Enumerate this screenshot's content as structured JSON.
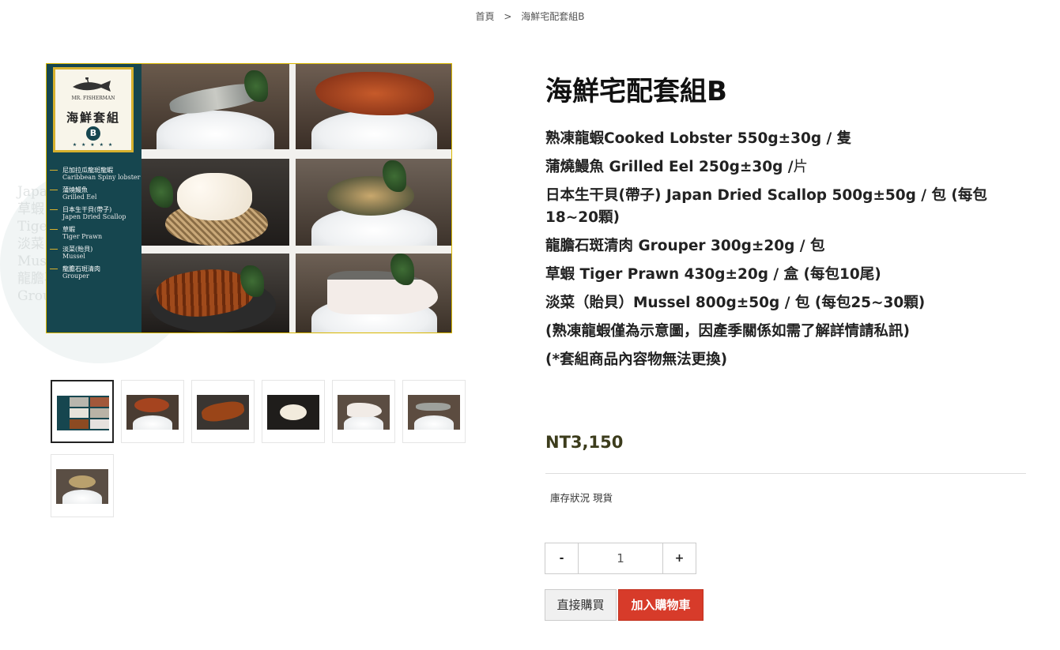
{
  "breadcrumb": {
    "home": "首頁",
    "separator": ">",
    "current": "海鮮宅配套組B"
  },
  "product_image": {
    "badge_brand": "MR. FISHERMAN",
    "badge_title": "海鮮套組",
    "badge_set": "B",
    "badge_stars": "★ ★ ★ ★ ★",
    "items": [
      {
        "zh": "尼加拉瓜龍斑龍蝦",
        "en": "Caribbean Spiny lobster"
      },
      {
        "zh": "蒲燒鰻魚",
        "en": "Grilled Eel"
      },
      {
        "zh": "日本生干貝(帶子)",
        "en": "Japen Dried Scallop"
      },
      {
        "zh": "草蝦",
        "en": "Tiger Prawn"
      },
      {
        "zh": "淡菜(貽貝)",
        "en": "Mussel"
      },
      {
        "zh": "龍膽石斑清肉",
        "en": "Grouper"
      }
    ],
    "watermark_lines": [
      "Japan Dried S",
      "草蝦",
      "Tiger Prawn",
      "淡菜",
      "Mussel",
      "龍膽石斑清肉",
      "Grouper"
    ]
  },
  "thumbnails": [
    {
      "name": "combo"
    },
    {
      "name": "lobster"
    },
    {
      "name": "eel"
    },
    {
      "name": "scallop"
    },
    {
      "name": "grouper"
    },
    {
      "name": "prawn"
    },
    {
      "name": "mussel"
    }
  ],
  "product": {
    "title": "海鮮宅配套組B",
    "lines": [
      {
        "text": "熟凍龍蝦Cooked Lobster 550g±30g / 隻"
      },
      {
        "text": "蒲燒鰻魚 Grilled Eel  250g±30g /",
        "suffix": "片"
      },
      {
        "text": "日本生干貝(帶子) Japan Dried Scallop  500g±50g / 包 (每包18~20顆)"
      },
      {
        "text": "龍膽石斑清肉 Grouper 300g±20g / 包"
      },
      {
        "text": "草蝦 Tiger Prawn  430g±20g / 盒 (每包10尾)"
      },
      {
        "text": "淡菜（貽貝）Mussel  800g±50g / 包 (每包25~30顆)"
      }
    ],
    "notes": [
      "(熟凍龍蝦僅為示意圖，因產季關係如需了解詳情請私訊)",
      "(*套組商品內容物無法更換)"
    ],
    "price": "NT3,150",
    "stock": "庫存狀況 現貨"
  },
  "quantity": {
    "minus": "-",
    "value": "1",
    "plus": "+"
  },
  "actions": {
    "buy_now": "直接購買",
    "add_to_cart": "加入購物車"
  },
  "colors": {
    "panel": "#16464f",
    "gold": "#d7b12e",
    "cart": "#d73b2a",
    "note": "#d35a1f"
  }
}
